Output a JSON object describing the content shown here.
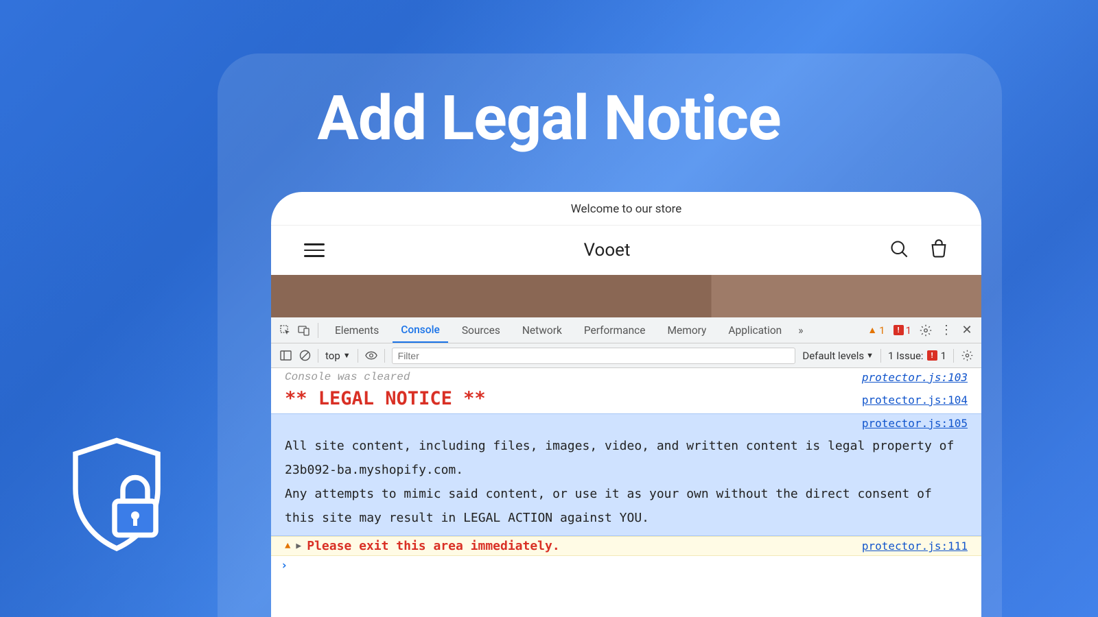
{
  "hero": {
    "title": "Add Legal Notice"
  },
  "store": {
    "announcement": "Welcome to our store",
    "name": "Vooet"
  },
  "devtools": {
    "tabs": [
      "Elements",
      "Console",
      "Sources",
      "Network",
      "Performance",
      "Memory",
      "Application"
    ],
    "active_tab": "Console",
    "overflow": "»",
    "warn_count": "1",
    "err_count": "1",
    "toolbar": {
      "context": "top",
      "filter_placeholder": "Filter",
      "levels": "Default levels",
      "issues_label": "1 Issue:",
      "issues_count": "1"
    },
    "logs": {
      "cleared": {
        "text": "Console was cleared",
        "src": "protector.js:103"
      },
      "legal_heading": {
        "text": "**  LEGAL NOTICE **",
        "src": "protector.js:104"
      },
      "info": {
        "src": "protector.js:105",
        "p1": "All site content, including files, images, video, and written content is legal property of 23b092-ba.myshopify.com.",
        "p2": "Any attempts to mimic said content, or use it as your own without the direct consent of this site may result in LEGAL ACTION against YOU."
      },
      "warn": {
        "text": "Please exit this area immediately.",
        "src": "protector.js:111"
      },
      "prompt": "›"
    }
  }
}
